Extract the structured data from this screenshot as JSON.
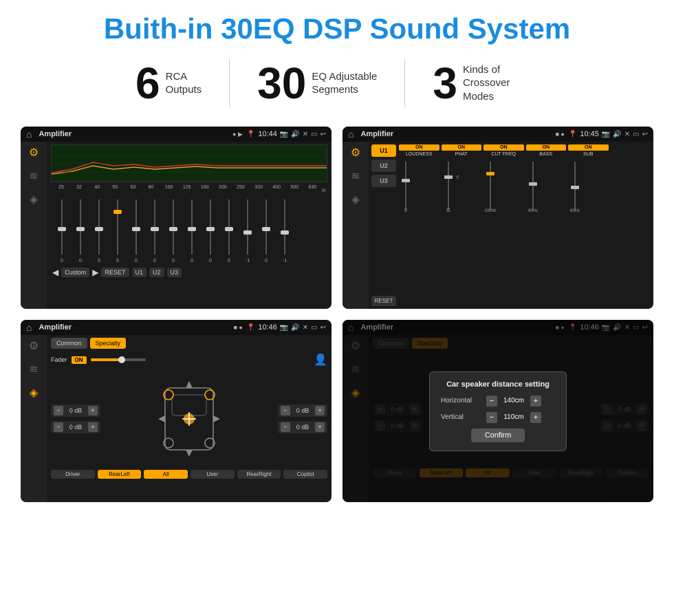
{
  "header": {
    "title": "Buith-in 30EQ DSP Sound System"
  },
  "stats": [
    {
      "number": "6",
      "label": "RCA\nOutputs"
    },
    {
      "number": "30",
      "label": "EQ Adjustable\nSegments"
    },
    {
      "number": "3",
      "label": "Kinds of\nCrossover Modes"
    }
  ],
  "screens": [
    {
      "id": "eq-screen",
      "status": {
        "time": "10:44",
        "title": "Amplifier"
      },
      "type": "eq"
    },
    {
      "id": "crossover-screen",
      "status": {
        "time": "10:45",
        "title": "Amplifier"
      },
      "type": "crossover"
    },
    {
      "id": "fader-screen",
      "status": {
        "time": "10:46",
        "title": "Amplifier"
      },
      "type": "fader"
    },
    {
      "id": "distance-screen",
      "status": {
        "time": "10:46",
        "title": "Amplifier"
      },
      "type": "distance"
    }
  ],
  "eq": {
    "frequencies": [
      "25",
      "32",
      "40",
      "50",
      "63",
      "80",
      "100",
      "125",
      "160",
      "200",
      "250",
      "320",
      "400",
      "500",
      "630"
    ],
    "values": [
      "0",
      "0",
      "0",
      "5",
      "0",
      "0",
      "0",
      "0",
      "0",
      "0",
      "-1",
      "0",
      "-1"
    ],
    "buttons": [
      "Custom",
      "RESET",
      "U1",
      "U2",
      "U3"
    ]
  },
  "crossover": {
    "presets": [
      "U1",
      "U2",
      "U3"
    ],
    "channels": [
      {
        "label": "LOUDNESS",
        "on": true
      },
      {
        "label": "PHAT",
        "on": true
      },
      {
        "label": "CUT FREQ",
        "on": true
      },
      {
        "label": "BASS",
        "on": true
      },
      {
        "label": "SUB",
        "on": true
      }
    ]
  },
  "fader": {
    "tabs": [
      "Common",
      "Specialty"
    ],
    "faderLabel": "Fader",
    "faderOn": "ON",
    "dbValues": [
      "0 dB",
      "0 dB",
      "0 dB",
      "0 dB"
    ],
    "speakerButtons": [
      "Driver",
      "RearLeft",
      "All",
      "User",
      "RearRight",
      "Copilot"
    ]
  },
  "distance": {
    "title": "Car speaker distance setting",
    "horizontal": {
      "label": "Horizontal",
      "value": "140cm"
    },
    "vertical": {
      "label": "Vertical",
      "value": "110cm"
    },
    "confirmBtn": "Confirm",
    "dbValues": [
      "0 dB",
      "0 dB"
    ],
    "speakerButtons": [
      "Driver",
      "RearLeft",
      "All",
      "User",
      "RearRight",
      "Copilot"
    ]
  }
}
